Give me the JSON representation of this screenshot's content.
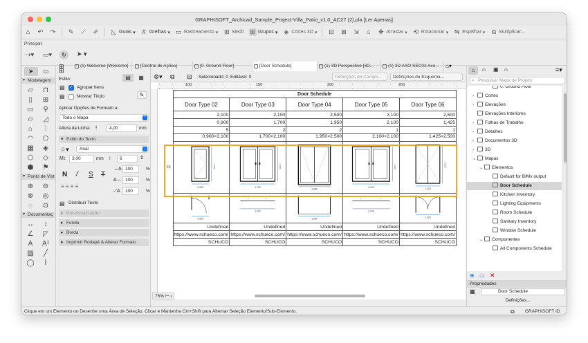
{
  "window": {
    "title": "GRAPHISOFT_Archicad_Sample_Project-Villa_Patio_v1.0_AC27 (2).pla [Ler Apenas]",
    "lights": [
      "#fe5f57",
      "#febc2e",
      "#28c840"
    ]
  },
  "toolbar": {
    "guias": "Guias",
    "grelhas": "Grelhas",
    "rastreamento": "Rastreamento",
    "medir": "Medir",
    "grupos": "Grupos",
    "cortes3d": "Cortes 3D",
    "arrastar": "Arrastar",
    "rotacionar": "Rotacionar",
    "espelhar": "Espelhar",
    "multiplicar": "Multiplicar..."
  },
  "principal": {
    "label": "Principal:"
  },
  "toolbox": {
    "modelagem": "Modelagem",
    "ponto_vista": "Ponto de Vist",
    "documentacao": "Documentaç"
  },
  "infobox": {
    "estilo": "Estilo:",
    "agrupar_itens": "Agrupar Itens",
    "mostrar_titulo": "Mostrar Título",
    "aplicar_opcoes": "Aplicar Opções de Formato a:",
    "todo_mapa": "Todo o Mapa",
    "altura_linha_label": "Altura da Linha:",
    "altura_linha_val": "4,00",
    "unit_mm": "mm",
    "estilo_texto": "Estilo do Texto",
    "font": "Arial",
    "font_size": "3,00",
    "line_spacing": "6",
    "pct1": "100",
    "pct2": "100",
    "pct3": "100",
    "pct_sign": "%",
    "bold": "N",
    "italic": "/",
    "underline": "S",
    "strike": "T",
    "distribuir_texto": "Distribuir Texto",
    "pre_visualizacao": "Pré-visualização",
    "fundo": "Fundo",
    "borda": "Borda",
    "imprimir_rodape": "Imprimir Rodapé & Alterar Formato"
  },
  "tabs": [
    "(1) Welcome [Welcome]",
    "[Central de Ações]",
    "[0. Ground Floor]",
    "[Door Schedule]",
    "(1) 3D Perspective [3D...",
    "(1) 3D AXO SEC02 Axo..."
  ],
  "viewbar": {
    "selecionado": "Selecionado: 0",
    "editavel": "Editável: 0",
    "def_campo": "Definições de Campo...",
    "def_esquema": "Definições de Esquema..."
  },
  "ruler": {
    "marks": [
      "100",
      "150",
      "200",
      "250"
    ]
  },
  "schedule": {
    "title": "Door Schedule",
    "headers": [
      "Door Type 02",
      "Door Type 03",
      "Door Type 04",
      "Door Type 05",
      "Door Type 06"
    ],
    "heights": [
      "2,100",
      "2,100",
      "2,500",
      "2,100",
      "2,500"
    ],
    "widths": [
      "0,900",
      "1,700",
      "1,950",
      "2,100",
      "1,425"
    ],
    "counts": [
      "5",
      "2",
      "2",
      "1",
      "1"
    ],
    "sizes": [
      "0,900×2,100",
      "1,700×2,100",
      "1,950×2,500",
      "2,100×2,100",
      "1,425×2,500"
    ],
    "elev_dims": [
      "0,900",
      "1,700",
      "1,950",
      "2,100",
      "1,425"
    ],
    "plan_dims": [
      "0,900",
      "1,700",
      "1,950",
      "2,100",
      "1,425"
    ],
    "elev_heights": [
      "2,100",
      "2,100",
      "",
      "2,100",
      "2,500"
    ],
    "status": [
      "Undefined",
      "Undefined",
      "Undefined",
      "Undefined",
      "Undefined"
    ],
    "links": [
      "https://www.schueco.com/",
      "https://www.schueco.com/",
      "https://www.schueco.com/",
      "https://www.schueco.com/",
      "https://www.schueco.com/"
    ],
    "brands": [
      "SCHUCO",
      "SCHUCO",
      "SCHUCO",
      "SCHUCO",
      "SCHUCO"
    ],
    "highlight_color": "#f5a623"
  },
  "zoom": "75%",
  "navigator": {
    "search_placeholder": "Pesquisar Mapa de Projeto",
    "items": [
      {
        "label": "0. Ground Floor",
        "level": 3,
        "exp": ""
      },
      {
        "label": "Cortes",
        "level": 1,
        "exp": "›"
      },
      {
        "label": "Elevações",
        "level": 1,
        "exp": "›"
      },
      {
        "label": "Elevações Interiores",
        "level": 1,
        "exp": ""
      },
      {
        "label": "Folhas de Trabalho",
        "level": 1,
        "exp": "›"
      },
      {
        "label": "Detalhes",
        "level": 1,
        "exp": "›"
      },
      {
        "label": "Documentos 3D",
        "level": 1,
        "exp": "›"
      },
      {
        "label": "3D",
        "level": 1,
        "exp": "›"
      },
      {
        "label": "Mapas",
        "level": 1,
        "exp": "⌄"
      },
      {
        "label": "Elementos",
        "level": 2,
        "exp": "⌄"
      },
      {
        "label": "Default for BIMx output",
        "level": 3,
        "exp": ""
      },
      {
        "label": "Door Schedule",
        "level": 3,
        "exp": "",
        "selected": true
      },
      {
        "label": "Kitchen Inventory",
        "level": 3,
        "exp": ""
      },
      {
        "label": "Lighting Equipments",
        "level": 3,
        "exp": ""
      },
      {
        "label": "Room Schedule",
        "level": 3,
        "exp": ""
      },
      {
        "label": "Sanitary Inventory",
        "level": 3,
        "exp": ""
      },
      {
        "label": "Window Schedule",
        "level": 3,
        "exp": ""
      },
      {
        "label": "Componentes",
        "level": 2,
        "exp": "⌄"
      },
      {
        "label": "All Components Schedule",
        "level": 3,
        "exp": ""
      }
    ],
    "propriedades": "Propriedades",
    "prop_value": "Door Schedule",
    "definicoes": "Definições..."
  },
  "statusbar": {
    "hint": "Clique em um Elemento ou Desenhe uma Área de Seleção. Clicar e Mantenha Ctrl+Shift para Alternar Seleção Elemento/Sub-Elemento.",
    "brand": "GRAPHISOFT ID"
  }
}
